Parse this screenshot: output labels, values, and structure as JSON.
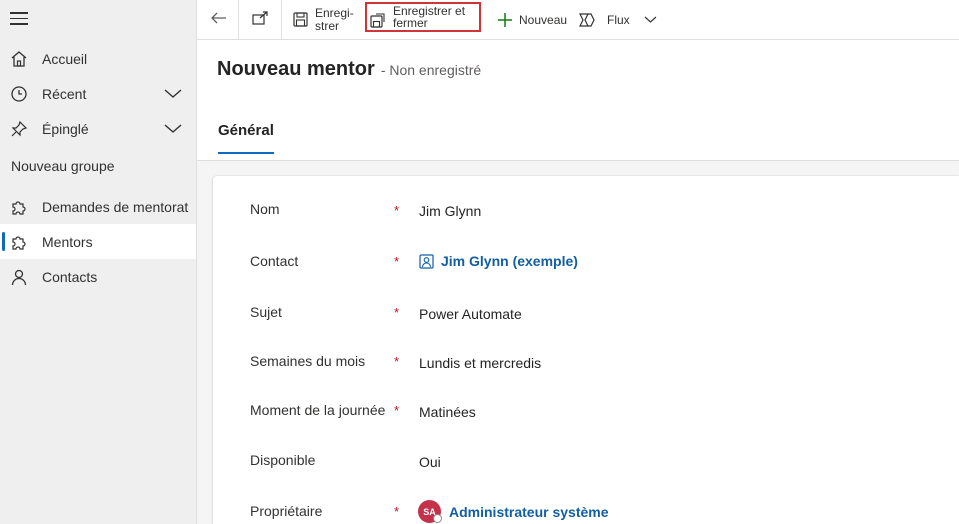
{
  "sidebar": {
    "items": [
      {
        "label": "Accueil",
        "icon": "home-icon"
      },
      {
        "label": "Récent",
        "icon": "clock-icon"
      },
      {
        "label": "Épinglé",
        "icon": "pin-icon"
      }
    ],
    "group_title": "Nouveau groupe",
    "group_items": [
      {
        "label": "Demandes de mentorat",
        "icon": "puzzle-icon"
      },
      {
        "label": "Mentors",
        "icon": "puzzle-icon",
        "active": true
      },
      {
        "label": "Contacts",
        "icon": "person-icon"
      }
    ]
  },
  "toolbar": {
    "save_label_line1": "Enregi-",
    "save_label_line2": "strer",
    "save_close_line1": "Enregistrer et",
    "save_close_line2": "fermer",
    "new_label": "Nouveau",
    "flow_label": "Flux"
  },
  "header": {
    "title": "Nouveau mentor",
    "subtitle": "- Non enregistré",
    "tab": "Général"
  },
  "form": {
    "fields": [
      {
        "label": "Nom",
        "required": "*",
        "value": "Jim Glynn"
      },
      {
        "label": "Contact",
        "required": "*",
        "value": "Jim Glynn (exemple)"
      },
      {
        "label": "Sujet",
        "required": "*",
        "value": "Power Automate"
      },
      {
        "label": "Semaines du mois",
        "required": "*",
        "value": "Lundis et mercredis"
      },
      {
        "label": "Moment de la journée",
        "required": "*",
        "value": "Matinées"
      },
      {
        "label": "Disponible",
        "required": "",
        "value": "Oui"
      },
      {
        "label": "Propriétaire",
        "required": "*",
        "value": "Administrateur système",
        "avatar": "SA"
      }
    ]
  },
  "colors": {
    "accent": "#0f6cbd",
    "required": "#c50f1f",
    "highlight": "#d13438",
    "avatar": "#c4314b",
    "new_plus": "#107c10"
  }
}
